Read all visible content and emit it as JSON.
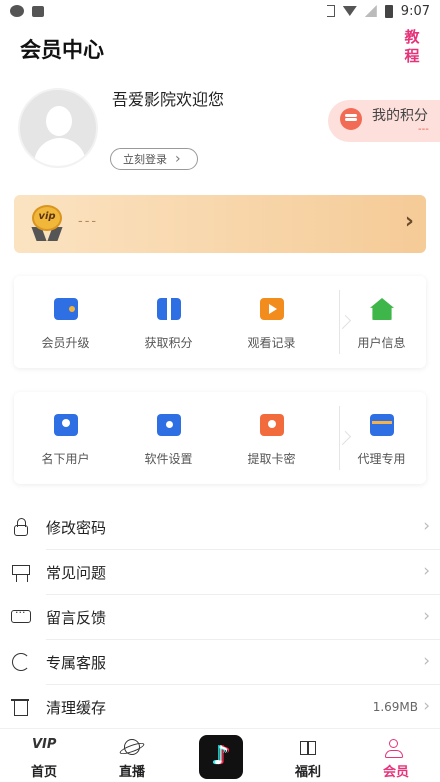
{
  "status_bar": {
    "time": "9:07"
  },
  "header": {
    "title": "会员中心",
    "tutorial": "教程"
  },
  "profile": {
    "welcome": "吾爱影院欢迎您",
    "login_label": "立刻登录",
    "login_chevron": "›"
  },
  "points": {
    "label": "我的积分",
    "value": "---"
  },
  "vip": {
    "badge": "vip",
    "status": "---",
    "arrow": "›"
  },
  "grid1": [
    {
      "label": "会员升级",
      "icon": "wallet-icon"
    },
    {
      "label": "获取积分",
      "icon": "gift-icon"
    },
    {
      "label": "观看记录",
      "icon": "video-icon"
    },
    {
      "label": "用户信息",
      "icon": "house-icon"
    }
  ],
  "grid2": [
    {
      "label": "名下用户",
      "icon": "contacts-icon"
    },
    {
      "label": "软件设置",
      "icon": "folder-user-icon"
    },
    {
      "label": "提取卡密",
      "icon": "flower-icon"
    },
    {
      "label": "代理专用",
      "icon": "card-icon"
    }
  ],
  "menu": [
    {
      "label": "修改密码",
      "icon": "lock-icon",
      "value": ""
    },
    {
      "label": "常见问题",
      "icon": "board-icon",
      "value": ""
    },
    {
      "label": "留言反馈",
      "icon": "chat-icon",
      "value": ""
    },
    {
      "label": "专属客服",
      "icon": "service-icon",
      "value": ""
    },
    {
      "label": "清理缓存",
      "icon": "trash-icon",
      "value": "1.69MB"
    }
  ],
  "menu_chevron": "›",
  "bottom_nav": [
    {
      "label": "首页",
      "icon": "vip-logo-icon",
      "glyph": "VIP"
    },
    {
      "label": "直播",
      "icon": "planet-icon"
    },
    {
      "label": "",
      "icon": "tiktok-icon",
      "glyph": "♪"
    },
    {
      "label": "福利",
      "icon": "gift-box-icon"
    },
    {
      "label": "会员",
      "icon": "person-icon",
      "active": true
    }
  ],
  "colors": {
    "accent": "#e6347a",
    "vip_gradient_start": "#fbe3c1",
    "vip_gradient_end": "#f5cb97",
    "points_bg": "#fde0dc"
  }
}
